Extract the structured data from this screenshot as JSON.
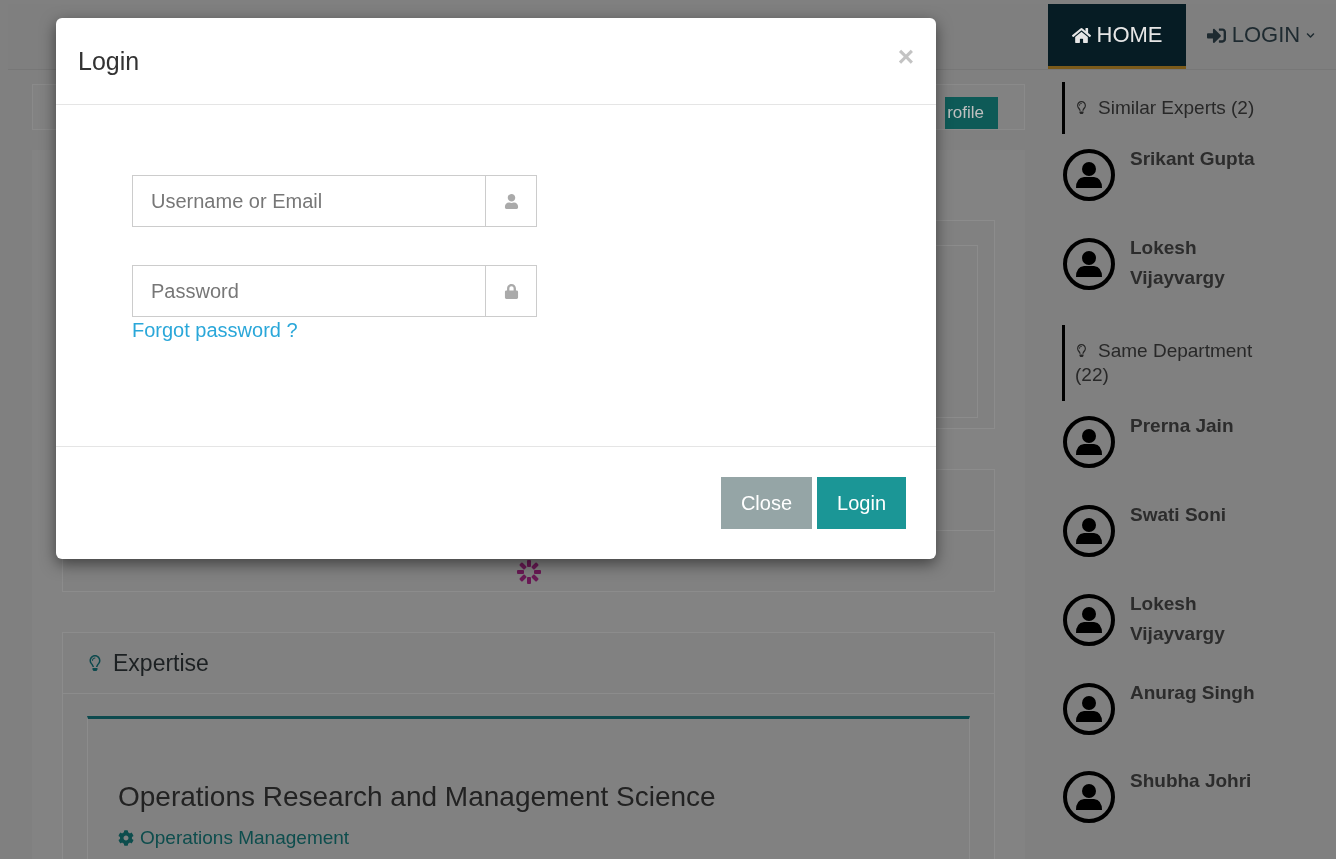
{
  "navbar": {
    "items": [
      {
        "label": "HOME",
        "selected": true,
        "dropdown": false
      },
      {
        "label": "LOGIN",
        "selected": false,
        "dropdown": true
      }
    ]
  },
  "profile_button": {
    "label": "rofile"
  },
  "expertise": {
    "heading": "Expertise",
    "title": "Operations Research and Management Science",
    "link": "Operations Management"
  },
  "sidebar": {
    "sections": [
      {
        "heading": "Similar Experts (2)",
        "experts": [
          "Srikant Gupta",
          "Lokesh Vijayvargy"
        ]
      },
      {
        "heading": "Same Department (22)",
        "experts": [
          "Prerna Jain",
          "Swati Soni",
          "Lokesh Vijayvargy",
          "Anurag Singh",
          "Shubha Johri"
        ]
      }
    ]
  },
  "modal": {
    "title": "Login",
    "close": "×",
    "fields": [
      {
        "placeholder": "Username or Email"
      },
      {
        "placeholder": "Password"
      }
    ],
    "forgot_link": "Forgot password ?",
    "buttons": [
      {
        "label": "Close",
        "kind": "secondary"
      },
      {
        "label": "Login",
        "kind": "primary"
      }
    ]
  }
}
